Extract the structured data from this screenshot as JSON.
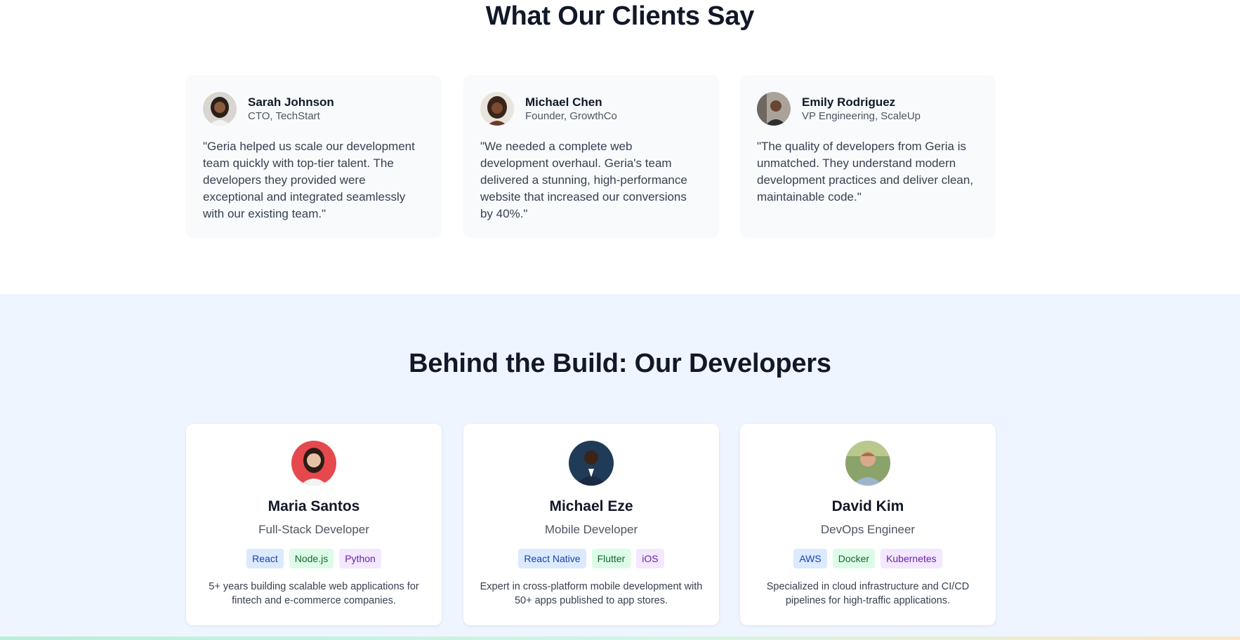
{
  "testimonials": {
    "title": "What Our Clients Say",
    "items": [
      {
        "name": "Sarah Johnson",
        "role": "CTO, TechStart",
        "quote": "\"Geria helped us scale our development team quickly with top-tier talent. The developers they provided were exceptional and integrated seamlessly with our existing team.\"",
        "avatar_icon": "avatar-photo-woman"
      },
      {
        "name": "Michael Chen",
        "role": "Founder, GrowthCo",
        "quote": "\"We needed a complete web development overhaul. Geria's team delivered a stunning, high-performance website that increased our conversions by 40%.\"",
        "avatar_icon": "avatar-photo-woman"
      },
      {
        "name": "Emily Rodriguez",
        "role": "VP Engineering, ScaleUp",
        "quote": "\"The quality of developers from Geria is unmatched. They understand modern development practices and deliver clean, maintainable code.\"",
        "avatar_icon": "avatar-photo-man"
      }
    ]
  },
  "developers": {
    "title": "Behind the Build: Our Developers",
    "items": [
      {
        "name": "Maria Santos",
        "role": "Full-Stack Developer",
        "tags": [
          "React",
          "Node.js",
          "Python"
        ],
        "description": "5+ years building scalable web applications for fintech and e-commerce companies.",
        "avatar_bg": "#e5484d"
      },
      {
        "name": "Michael Eze",
        "role": "Mobile Developer",
        "tags": [
          "React Native",
          "Flutter",
          "iOS"
        ],
        "description": "Expert in cross-platform mobile development with 50+ apps published to app stores.",
        "avatar_bg": "#1f3b57"
      },
      {
        "name": "David Kim",
        "role": "DevOps Engineer",
        "tags": [
          "AWS",
          "Docker",
          "Kubernetes"
        ],
        "description": "Specialized in cloud infrastructure and CI/CD pipelines for high-traffic applications.",
        "avatar_bg": "#8aa36a"
      }
    ]
  },
  "colors": {
    "tag_blue": "#dbeafe",
    "tag_green": "#dcfce7",
    "tag_purple": "#f3e8ff",
    "developers_bg": "#eef5ff",
    "testimonial_card_bg": "#f8fafc"
  }
}
